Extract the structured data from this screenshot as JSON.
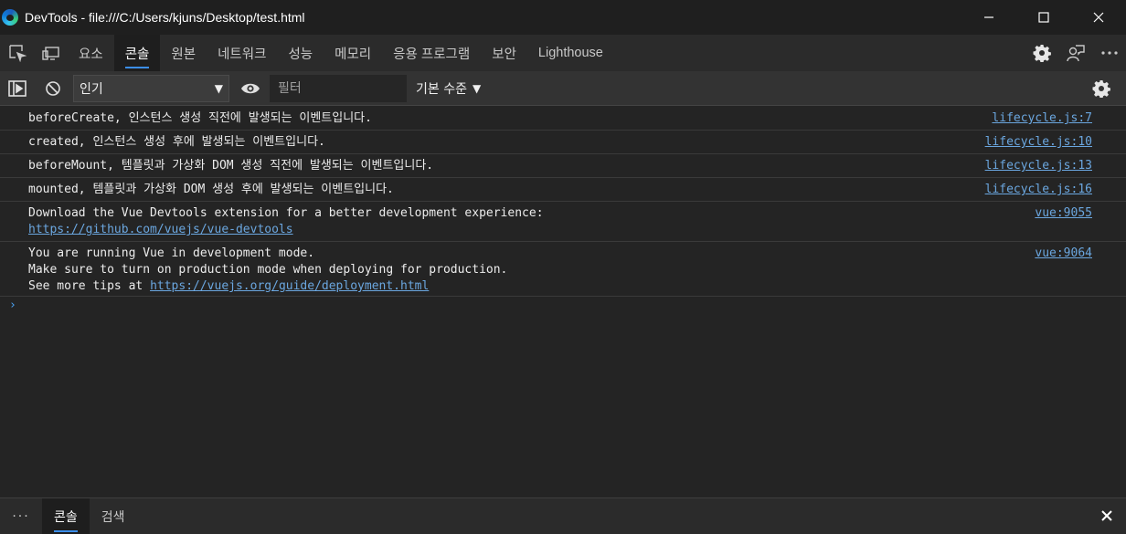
{
  "window": {
    "title": "DevTools - file:///C:/Users/kjuns/Desktop/test.html"
  },
  "tabs": [
    {
      "label": "요소"
    },
    {
      "label": "콘솔",
      "active": true
    },
    {
      "label": "원본"
    },
    {
      "label": "네트워크"
    },
    {
      "label": "성능"
    },
    {
      "label": "메모리"
    },
    {
      "label": "응용 프로그램"
    },
    {
      "label": "보안"
    },
    {
      "label": "Lighthouse"
    }
  ],
  "toolbar": {
    "context_select": "인기",
    "filter_placeholder": "필터",
    "log_level": "기본 수준"
  },
  "console": {
    "messages": [
      {
        "lines": [
          "beforeCreate, 인스턴스 생성 직전에 발생되는 이벤트입니다."
        ],
        "source": "lifecycle.js:7"
      },
      {
        "lines": [
          "created, 인스턴스 생성 후에 발생되는 이벤트입니다."
        ],
        "source": "lifecycle.js:10"
      },
      {
        "lines": [
          "beforeMount, 템플릿과 가상화 DOM 생성 직전에 발생되는 이벤트입니다."
        ],
        "source": "lifecycle.js:13"
      },
      {
        "lines": [
          "mounted, 템플릿과 가상화 DOM 생성 후에 발생되는 이벤트입니다."
        ],
        "source": "lifecycle.js:16"
      },
      {
        "lines": [
          "Download the Vue Devtools extension for a better development experience:"
        ],
        "link": "https://github.com/vuejs/vue-devtools",
        "source": "vue:9055"
      },
      {
        "lines": [
          "You are running Vue in development mode.",
          "Make sure to turn on production mode when deploying for production.",
          "See more tips at "
        ],
        "link": "https://vuejs.org/guide/deployment.html",
        "source": "vue:9064"
      }
    ],
    "prompt_glyph": "›"
  },
  "drawer": {
    "more": "···",
    "tabs": [
      {
        "label": "콘솔",
        "active": true
      },
      {
        "label": "검색"
      }
    ]
  },
  "colors": {
    "accent": "#3b8eea",
    "link": "#6ba7e0"
  }
}
